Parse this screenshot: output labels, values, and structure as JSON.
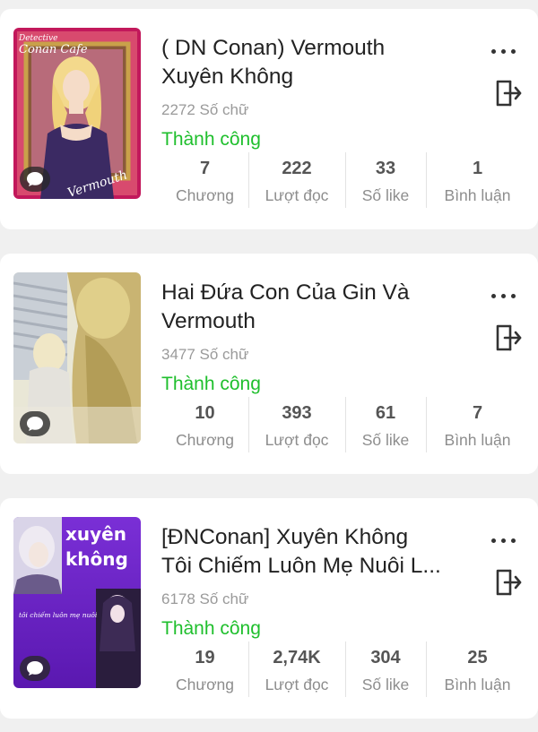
{
  "stories": [
    {
      "title_lines": [
        "( DN Conan) Vermouth",
        "Xuyên Không"
      ],
      "words": "2272 Số chữ",
      "status": "Thành công",
      "stats": [
        {
          "value": "7",
          "label": "Chương"
        },
        {
          "value": "222",
          "label": "Lượt đọc"
        },
        {
          "value": "33",
          "label": "Số like"
        },
        {
          "value": "1",
          "label": "Bình luận"
        }
      ],
      "cover": {
        "top_text": "Detective",
        "top_text_2": "Conan Cafe",
        "bottom_text": "Vermouth",
        "icon": "chat-icon"
      }
    },
    {
      "title_lines": [
        "Hai Đứa Con Của Gin Và",
        "Vermouth"
      ],
      "words": "3477 Số chữ",
      "status": "Thành công",
      "stats": [
        {
          "value": "10",
          "label": "Chương"
        },
        {
          "value": "393",
          "label": "Lượt đọc"
        },
        {
          "value": "61",
          "label": "Số like"
        },
        {
          "value": "7",
          "label": "Bình luận"
        }
      ],
      "cover": {
        "icon": "chat-icon"
      }
    },
    {
      "title_lines": [
        "[ĐNConan] Xuyên Không",
        "Tôi Chiếm Luôn Mẹ Nuôi L..."
      ],
      "words": "6178 Số chữ",
      "status": "Thành công",
      "stats": [
        {
          "value": "19",
          "label": "Chương"
        },
        {
          "value": "2,74K",
          "label": "Lượt đọc"
        },
        {
          "value": "304",
          "label": "Số like"
        },
        {
          "value": "25",
          "label": "Bình luận"
        }
      ],
      "cover": {
        "big_text_1": "xuyên",
        "big_text_2": "không",
        "small_text": "tôi chiếm luôn mẹ nuôi",
        "icon": "chat-icon"
      }
    }
  ],
  "colors": {
    "status_green": "#1fbf2d",
    "background": "#f0f0f0",
    "card": "#ffffff"
  },
  "icons": {
    "more": "more-dots-icon",
    "exit": "exit-door-icon",
    "chat": "chat-bubble-icon"
  }
}
